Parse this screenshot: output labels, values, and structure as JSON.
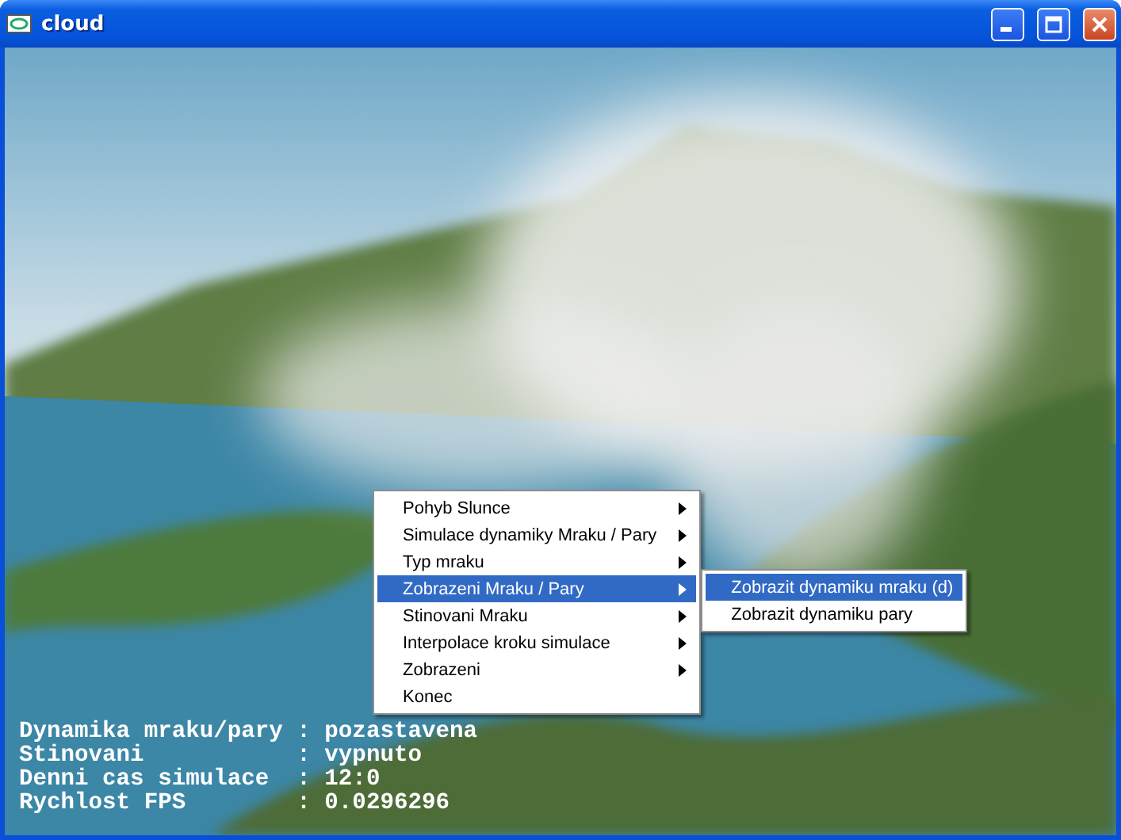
{
  "window": {
    "title": "cloud"
  },
  "context_menu": {
    "items": [
      {
        "label": "Pohyb Slunce",
        "submenu": true,
        "selected": false
      },
      {
        "label": "Simulace dynamiky Mraku / Pary",
        "submenu": true,
        "selected": false
      },
      {
        "label": "Typ mraku",
        "submenu": true,
        "selected": false
      },
      {
        "label": "Zobrazeni Mraku / Pary",
        "submenu": true,
        "selected": true
      },
      {
        "label": "Stinovani Mraku",
        "submenu": true,
        "selected": false
      },
      {
        "label": "Interpolace kroku simulace",
        "submenu": true,
        "selected": false
      },
      {
        "label": "Zobrazeni",
        "submenu": true,
        "selected": false
      },
      {
        "label": "Konec",
        "submenu": false,
        "selected": false
      }
    ]
  },
  "submenu": {
    "items": [
      {
        "label": "Zobrazit dynamiku mraku (d)",
        "selected": true
      },
      {
        "label": "Zobrazit dynamiku pary",
        "selected": false
      }
    ]
  },
  "status_lines": [
    "Dynamika mraku/pary : pozastavena",
    "Stinovani           : vypnuto",
    "Denni cas simulace  : 12:0",
    "Rychlost FPS        : 0.0296296"
  ]
}
